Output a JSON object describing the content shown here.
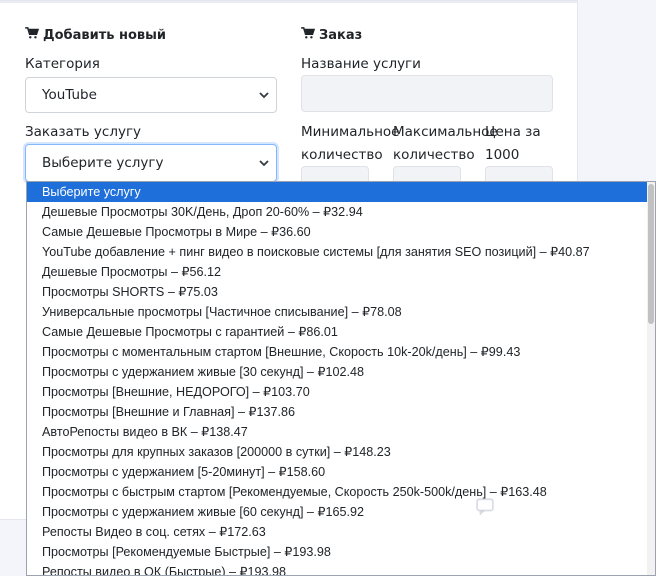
{
  "left_section": {
    "title": "Добавить новый",
    "category_label": "Категория",
    "category_value": "YouTube",
    "service_label": "Заказать услугу",
    "service_value": "Выберите услугу"
  },
  "right_section": {
    "title": "Заказ",
    "service_name_label": "Название услуги",
    "min_label_1": "Минимальное",
    "min_label_2": "количество",
    "max_label_1": "Максимальное",
    "max_label_2": "количество",
    "price_label_1": "Цена за",
    "price_label_2": "1000"
  },
  "dropdown": {
    "options": [
      "Выберите услугу",
      "Дешевые Просмотры 30K/День, Дроп 20-60% – ₽32.94",
      "Самые Дешевые Просмотры в Мире – ₽36.60",
      "YouTube добавление + пинг видео в поисковые системы [для занятия SEO позиций] – ₽40.87",
      "Дешевые Просмотры – ₽56.12",
      "Просмотры SHORTS – ₽75.03",
      "Универсальные просмотры [Частичное списывание] – ₽78.08",
      "Самые Дешевые Просмотры с гарантией – ₽86.01",
      "Просмотры с моментальным стартом [Внешние, Скорость 10k-20k/день] – ₽99.43",
      "Просмотры с удержанием живые [30 секунд] – ₽102.48",
      "Просмотры [Внешние, НЕДОРОГО] – ₽103.70",
      "Просмотры [Внешние и Главная] – ₽137.86",
      "АвтоРепосты видео в ВК – ₽138.47",
      "Просмотры для крупных заказов [200000 в сутки] – ₽148.23",
      "Просмотры с удержанием [5-20минут] – ₽158.60",
      "Просмотры с быстрым стартом [Рекомендуемые, Скорость 250k-500k/день] – ₽163.48",
      "Просмотры с удержанием живые [60 секунд] – ₽165.92",
      "Репосты Видео в соц. сетях – ₽172.63",
      "Просмотры [Рекомендуемые Быстрые] – ₽193.98",
      "Репосты видео в ОК (Быстрые) – ₽193.98"
    ],
    "selected_index": 0
  },
  "colors": {
    "accent": "#1e6fd9",
    "page_bg": "#f3f5fb"
  }
}
